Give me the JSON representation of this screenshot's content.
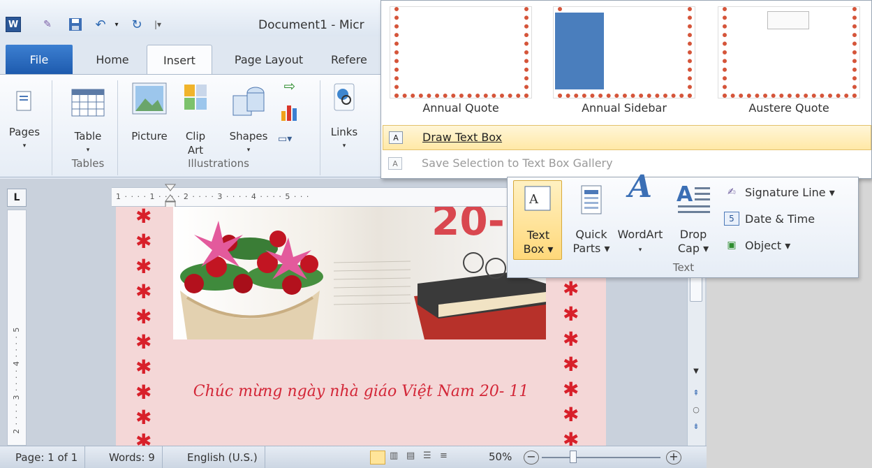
{
  "window": {
    "doc_title": "Document1 - Micr",
    "app_icon_letter": "W"
  },
  "tabs": {
    "file": "File",
    "home": "Home",
    "insert": "Insert",
    "page_layout": "Page Layout",
    "references": "Refere"
  },
  "ribbon": {
    "pages": "Pages",
    "table": "Table",
    "picture": "Picture",
    "clip_art": "Clip\nArt",
    "shapes": "Shapes",
    "links": "Links",
    "group_tables": "Tables",
    "group_illustrations": "Illustrations"
  },
  "gallery": {
    "items": [
      {
        "label": "Annual Quote"
      },
      {
        "label": "Annual Sidebar"
      },
      {
        "label": "Austere Quote"
      }
    ],
    "draw_text_box": "Draw Text Box",
    "save_selection": "Save Selection to Text Box Gallery"
  },
  "text_group": {
    "text_box": "Text\nBox ▾",
    "quick_parts": "Quick\nParts ▾",
    "wordart": "WordArt",
    "drop_cap": "Drop\nCap ▾",
    "signature_line": "Signature Line ▾",
    "date_time": "Date & Time",
    "object": "Object ▾",
    "label": "Text"
  },
  "document": {
    "greeting": "Chúc mừng ngày nhà giáo Việt Nam 20- 11",
    "banner_text": "20-"
  },
  "ruler": {
    "h_marks": "1 · · · · 1 · · · · 2 · · · · 3 · · · · 4 · · · · 5 · · ·",
    "v_marks": "2 · · · · 3 · · · · 4 · · · · 5"
  },
  "status": {
    "page": "Page: 1 of 1",
    "words": "Words: 9",
    "language": "English (U.S.)",
    "zoom": "50%"
  },
  "colors": {
    "file_tab": "#2b6bc4",
    "highlight": "#ffe39a",
    "page": "#f4d7d7",
    "greeting": "#d32637"
  }
}
